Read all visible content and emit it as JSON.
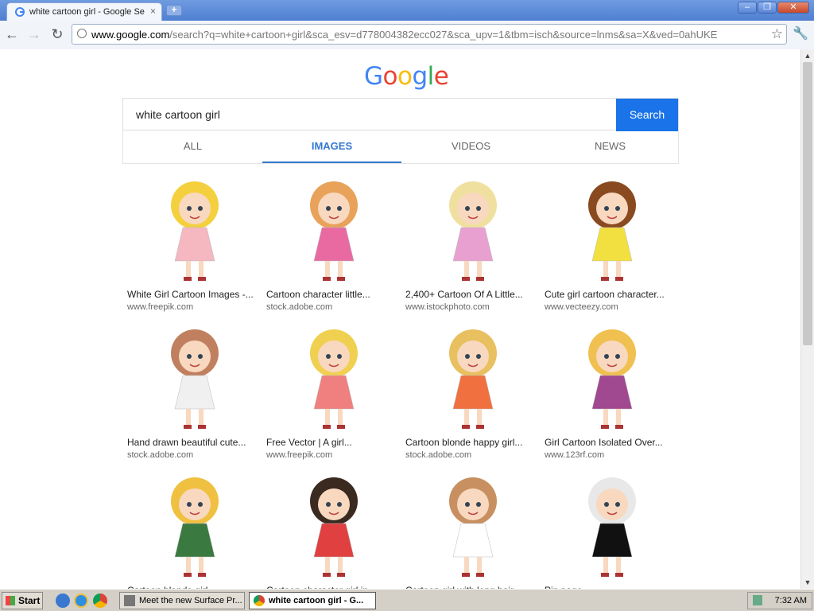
{
  "browser": {
    "tab_title": "white cartoon girl - Google Se",
    "tab_close": "×",
    "new_tab": "+",
    "window_controls": [
      "‒",
      "❐",
      "✕"
    ],
    "url_domain": "www.google.com",
    "url_path": "/search?q=white+cartoon+girl&sca_esv=d778004382ecc027&sca_upv=1&tbm=isch&source=lnms&sa=X&ved=0ahUKE",
    "back_icon": "←",
    "forward_icon": "→",
    "reload_icon": "↻",
    "star_icon": "☆",
    "wrench_icon": "🔧"
  },
  "page": {
    "logo_letters": [
      {
        "ch": "G",
        "color": "#4285F4"
      },
      {
        "ch": "o",
        "color": "#EA4335"
      },
      {
        "ch": "o",
        "color": "#FBBC05"
      },
      {
        "ch": "g",
        "color": "#4285F4"
      },
      {
        "ch": "l",
        "color": "#34A853"
      },
      {
        "ch": "e",
        "color": "#EA4335"
      }
    ],
    "search_value": "white cartoon girl",
    "search_button": "Search",
    "tabs": [
      {
        "label": "ALL",
        "active": false
      },
      {
        "label": "IMAGES",
        "active": true
      },
      {
        "label": "VIDEOS",
        "active": false
      },
      {
        "label": "NEWS",
        "active": false
      }
    ],
    "results": [
      {
        "title": "White Girl Cartoon Images -...",
        "source": "www.freepik.com",
        "hair": "#f4d03f",
        "outfit": "#f5b7c0"
      },
      {
        "title": "Cartoon character little...",
        "source": "stock.adobe.com",
        "hair": "#e8a25a",
        "outfit": "#e86aa0"
      },
      {
        "title": "2,400+ Cartoon Of A Little...",
        "source": "www.istockphoto.com",
        "hair": "#f0e0a0",
        "outfit": "#e8a0d0"
      },
      {
        "title": "Cute girl cartoon character...",
        "source": "www.vecteezy.com",
        "hair": "#8a4a20",
        "outfit": "#f2e040"
      },
      {
        "title": "Hand drawn beautiful cute...",
        "source": "stock.adobe.com",
        "hair": "#c08060",
        "outfit": "#f0f0f0"
      },
      {
        "title": "Free Vector | A girl...",
        "source": "www.freepik.com",
        "hair": "#f0d050",
        "outfit": "#f08080"
      },
      {
        "title": "Cartoon blonde happy girl...",
        "source": "stock.adobe.com",
        "hair": "#e8c060",
        "outfit": "#f07040"
      },
      {
        "title": "Girl Cartoon Isolated Over...",
        "source": "www.123rf.com",
        "hair": "#f0c050",
        "outfit": "#a04890"
      },
      {
        "title": "Cartoon blonde girl...",
        "source": "",
        "hair": "#f0c040",
        "outfit": "#3a7a40"
      },
      {
        "title": "Cartoon character girl in...",
        "source": "",
        "hair": "#3a2a20",
        "outfit": "#e04040"
      },
      {
        "title": "Cartoon girl with long hair...",
        "source": "",
        "hair": "#c89060",
        "outfit": "#ffffff"
      },
      {
        "title": "Pin page",
        "source": "",
        "hair": "#e8e8e8",
        "outfit": "#111111"
      }
    ]
  },
  "taskbar": {
    "start": "Start",
    "items": [
      {
        "label": "Meet the new Surface Pr...",
        "active": false
      },
      {
        "label": "white cartoon girl - G...",
        "active": true
      }
    ],
    "clock": "7:32 AM"
  },
  "scrollbar": {
    "up": "▲",
    "down": "▼"
  }
}
